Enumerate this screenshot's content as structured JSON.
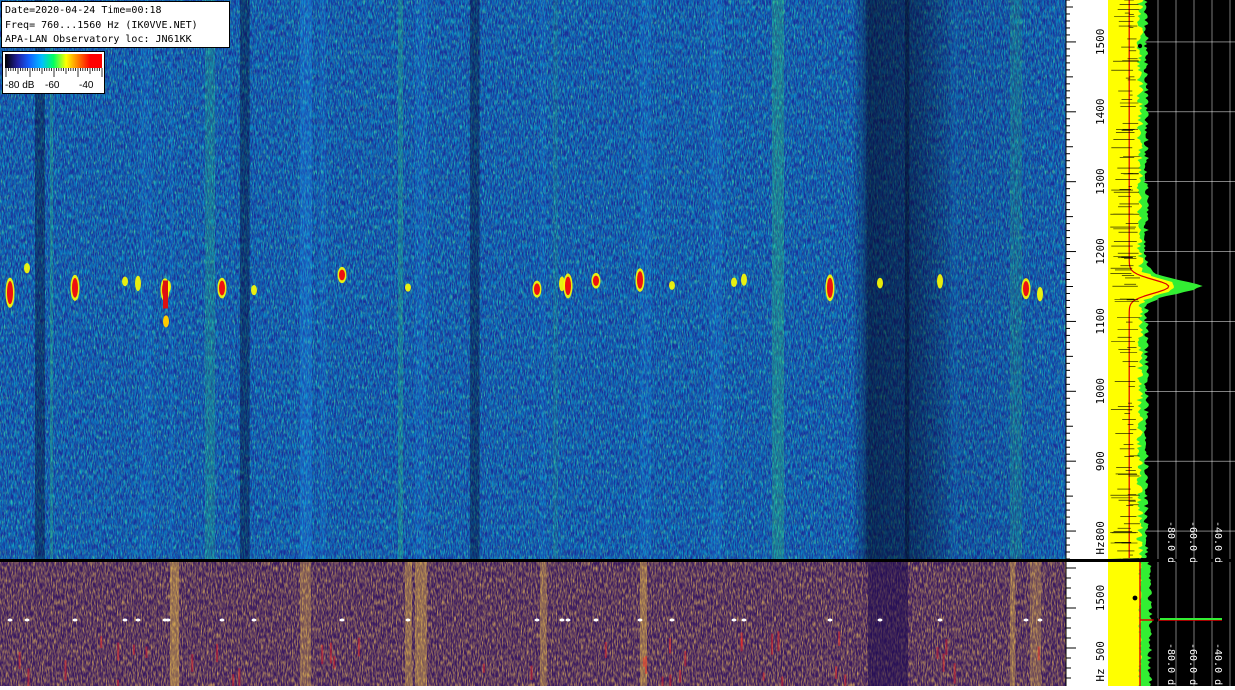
{
  "header": {
    "line1": "Date=2020-04-24 Time=00:18",
    "line2": "Freq= 760...1560 Hz (IK0VVE.NET)",
    "line3": "APA-LAN Observatory loc: JN61KK"
  },
  "colorbar": {
    "labels": [
      "-80 dB",
      "-60",
      "-40"
    ],
    "stops": [
      "#000000",
      "#2020a0",
      "#1060ff",
      "#00c0ff",
      "#00ff60",
      "#ffff00",
      "#ff8000",
      "#ff0000",
      "#ff0000"
    ]
  },
  "colors": {
    "yellow": "#ffff00",
    "green": "#33ee33",
    "red_trace": "#dd0000",
    "panel_bg": "#000000"
  },
  "chart_data": [
    {
      "type": "heatmap",
      "title": "",
      "xlabel": "",
      "ylabel": "Hz",
      "y_unit_label": "Hz",
      "ylim": [
        760,
        1560
      ],
      "yticks": [
        "800",
        "900",
        "1000",
        "1100",
        "1200",
        "1300",
        "1400",
        "1500"
      ],
      "colorscale_db": [
        -80,
        -40
      ],
      "signal_band_hz": 1150,
      "spectrum_panel": {
        "x_labels": [
          "-80.0 dB",
          "-60.0 dB",
          "-40.0 dB"
        ],
        "xlim_db": [
          -80,
          -40
        ]
      }
    },
    {
      "type": "heatmap",
      "title": "",
      "ylabel": "Hz",
      "y_unit_label": "Hz",
      "yticks": [
        "1500",
        "500"
      ],
      "spectrum_panel": {
        "x_labels": [
          "-80.0 dB",
          "-60.0 dB",
          "-40.0 dB"
        ],
        "xlim_db": [
          -80,
          -40
        ]
      }
    }
  ]
}
